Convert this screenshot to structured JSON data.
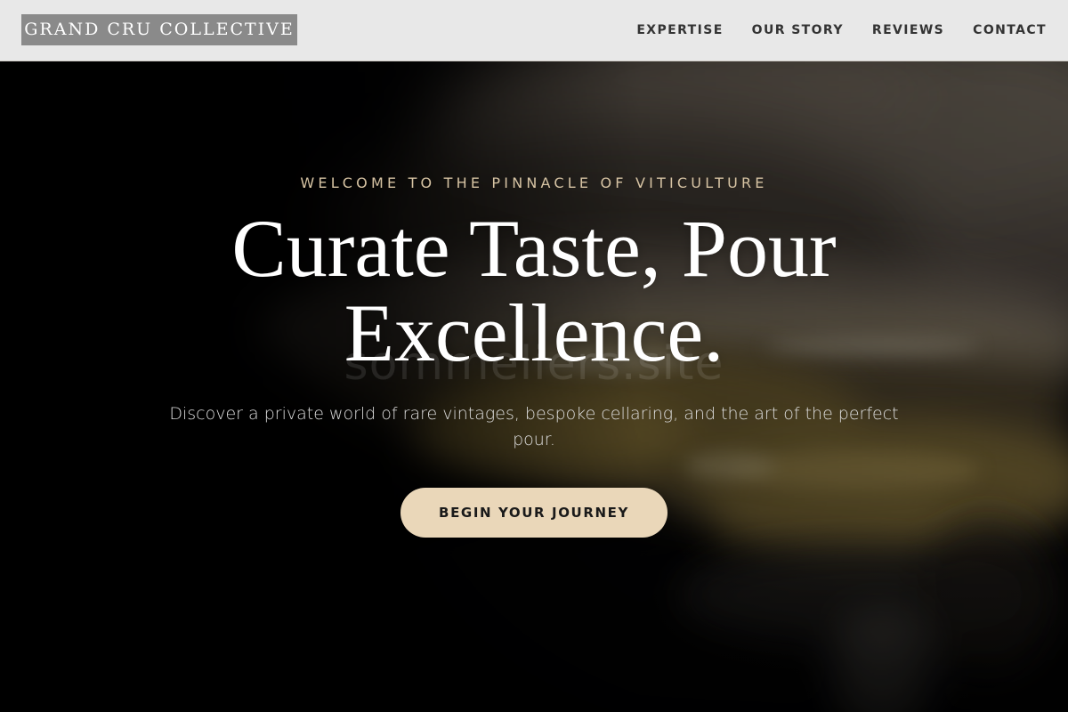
{
  "header": {
    "logo": "GRAND CRU COLLECTIVE",
    "nav": [
      {
        "label": "EXPERTISE"
      },
      {
        "label": "OUR STORY"
      },
      {
        "label": "REVIEWS"
      },
      {
        "label": "CONTACT"
      }
    ]
  },
  "hero": {
    "eyebrow": "WELCOME TO THE PINNACLE OF VITICULTURE",
    "headline": "Curate Taste, Pour Excellence.",
    "watermark": "sommeliers.site",
    "subtitle": "Discover a private world of rare vintages, bespoke cellaring, and the art of the perfect pour.",
    "cta": "BEGIN YOUR JOURNEY"
  },
  "colors": {
    "header_bg": "#e8e8e8",
    "logo_bg": "#8a8a8a",
    "nav_text": "#333333",
    "eyebrow": "#d6c3a3",
    "cta_bg": "#ead7b9",
    "hero_bg": "#040404"
  }
}
